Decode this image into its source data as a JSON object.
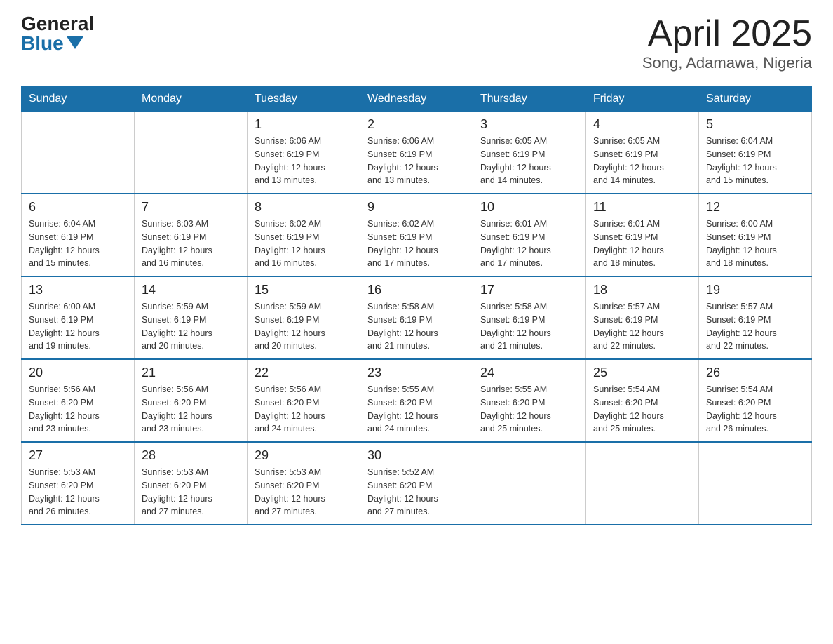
{
  "logo": {
    "general": "General",
    "blue": "Blue"
  },
  "title": "April 2025",
  "subtitle": "Song, Adamawa, Nigeria",
  "days_of_week": [
    "Sunday",
    "Monday",
    "Tuesday",
    "Wednesday",
    "Thursday",
    "Friday",
    "Saturday"
  ],
  "weeks": [
    [
      {
        "day": "",
        "info": ""
      },
      {
        "day": "",
        "info": ""
      },
      {
        "day": "1",
        "info": "Sunrise: 6:06 AM\nSunset: 6:19 PM\nDaylight: 12 hours\nand 13 minutes."
      },
      {
        "day": "2",
        "info": "Sunrise: 6:06 AM\nSunset: 6:19 PM\nDaylight: 12 hours\nand 13 minutes."
      },
      {
        "day": "3",
        "info": "Sunrise: 6:05 AM\nSunset: 6:19 PM\nDaylight: 12 hours\nand 14 minutes."
      },
      {
        "day": "4",
        "info": "Sunrise: 6:05 AM\nSunset: 6:19 PM\nDaylight: 12 hours\nand 14 minutes."
      },
      {
        "day": "5",
        "info": "Sunrise: 6:04 AM\nSunset: 6:19 PM\nDaylight: 12 hours\nand 15 minutes."
      }
    ],
    [
      {
        "day": "6",
        "info": "Sunrise: 6:04 AM\nSunset: 6:19 PM\nDaylight: 12 hours\nand 15 minutes."
      },
      {
        "day": "7",
        "info": "Sunrise: 6:03 AM\nSunset: 6:19 PM\nDaylight: 12 hours\nand 16 minutes."
      },
      {
        "day": "8",
        "info": "Sunrise: 6:02 AM\nSunset: 6:19 PM\nDaylight: 12 hours\nand 16 minutes."
      },
      {
        "day": "9",
        "info": "Sunrise: 6:02 AM\nSunset: 6:19 PM\nDaylight: 12 hours\nand 17 minutes."
      },
      {
        "day": "10",
        "info": "Sunrise: 6:01 AM\nSunset: 6:19 PM\nDaylight: 12 hours\nand 17 minutes."
      },
      {
        "day": "11",
        "info": "Sunrise: 6:01 AM\nSunset: 6:19 PM\nDaylight: 12 hours\nand 18 minutes."
      },
      {
        "day": "12",
        "info": "Sunrise: 6:00 AM\nSunset: 6:19 PM\nDaylight: 12 hours\nand 18 minutes."
      }
    ],
    [
      {
        "day": "13",
        "info": "Sunrise: 6:00 AM\nSunset: 6:19 PM\nDaylight: 12 hours\nand 19 minutes."
      },
      {
        "day": "14",
        "info": "Sunrise: 5:59 AM\nSunset: 6:19 PM\nDaylight: 12 hours\nand 20 minutes."
      },
      {
        "day": "15",
        "info": "Sunrise: 5:59 AM\nSunset: 6:19 PM\nDaylight: 12 hours\nand 20 minutes."
      },
      {
        "day": "16",
        "info": "Sunrise: 5:58 AM\nSunset: 6:19 PM\nDaylight: 12 hours\nand 21 minutes."
      },
      {
        "day": "17",
        "info": "Sunrise: 5:58 AM\nSunset: 6:19 PM\nDaylight: 12 hours\nand 21 minutes."
      },
      {
        "day": "18",
        "info": "Sunrise: 5:57 AM\nSunset: 6:19 PM\nDaylight: 12 hours\nand 22 minutes."
      },
      {
        "day": "19",
        "info": "Sunrise: 5:57 AM\nSunset: 6:19 PM\nDaylight: 12 hours\nand 22 minutes."
      }
    ],
    [
      {
        "day": "20",
        "info": "Sunrise: 5:56 AM\nSunset: 6:20 PM\nDaylight: 12 hours\nand 23 minutes."
      },
      {
        "day": "21",
        "info": "Sunrise: 5:56 AM\nSunset: 6:20 PM\nDaylight: 12 hours\nand 23 minutes."
      },
      {
        "day": "22",
        "info": "Sunrise: 5:56 AM\nSunset: 6:20 PM\nDaylight: 12 hours\nand 24 minutes."
      },
      {
        "day": "23",
        "info": "Sunrise: 5:55 AM\nSunset: 6:20 PM\nDaylight: 12 hours\nand 24 minutes."
      },
      {
        "day": "24",
        "info": "Sunrise: 5:55 AM\nSunset: 6:20 PM\nDaylight: 12 hours\nand 25 minutes."
      },
      {
        "day": "25",
        "info": "Sunrise: 5:54 AM\nSunset: 6:20 PM\nDaylight: 12 hours\nand 25 minutes."
      },
      {
        "day": "26",
        "info": "Sunrise: 5:54 AM\nSunset: 6:20 PM\nDaylight: 12 hours\nand 26 minutes."
      }
    ],
    [
      {
        "day": "27",
        "info": "Sunrise: 5:53 AM\nSunset: 6:20 PM\nDaylight: 12 hours\nand 26 minutes."
      },
      {
        "day": "28",
        "info": "Sunrise: 5:53 AM\nSunset: 6:20 PM\nDaylight: 12 hours\nand 27 minutes."
      },
      {
        "day": "29",
        "info": "Sunrise: 5:53 AM\nSunset: 6:20 PM\nDaylight: 12 hours\nand 27 minutes."
      },
      {
        "day": "30",
        "info": "Sunrise: 5:52 AM\nSunset: 6:20 PM\nDaylight: 12 hours\nand 27 minutes."
      },
      {
        "day": "",
        "info": ""
      },
      {
        "day": "",
        "info": ""
      },
      {
        "day": "",
        "info": ""
      }
    ]
  ]
}
